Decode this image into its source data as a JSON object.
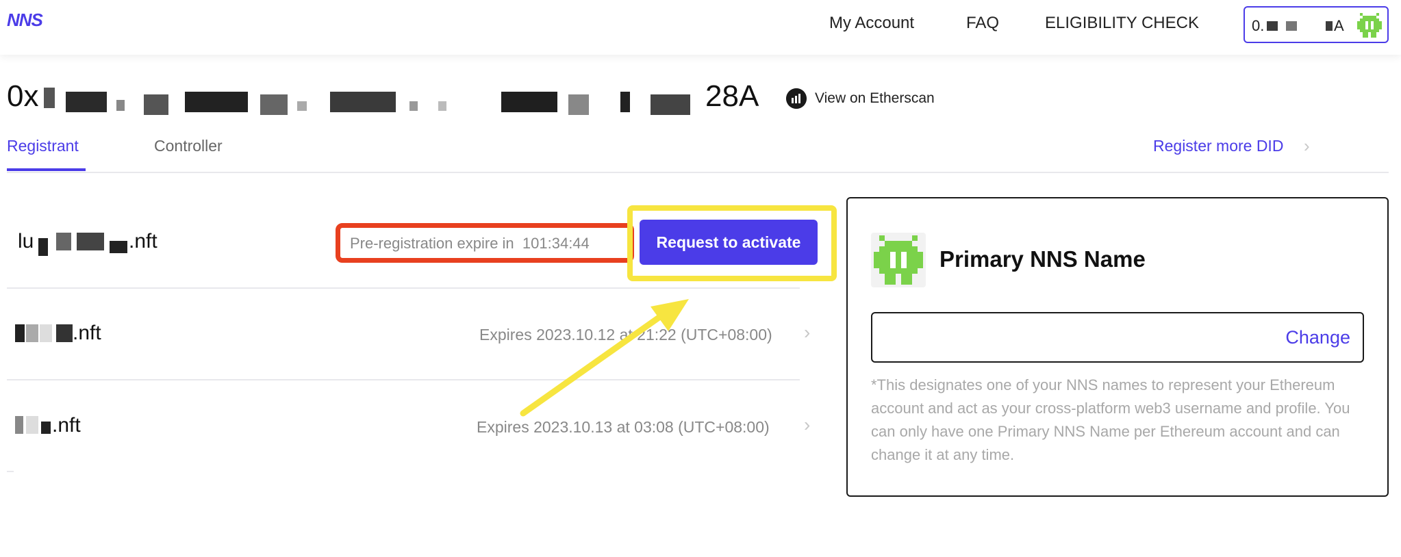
{
  "header": {
    "logo": "NNS",
    "nav": [
      "My Account",
      "FAQ",
      "ELIGIBILITY CHECK"
    ],
    "wallet_prefix": "0.",
    "wallet_suffix": "A"
  },
  "address": {
    "prefix": "0x",
    "suffix": "28A",
    "etherscan_label": "View on Etherscan"
  },
  "tabs": {
    "registrant": "Registrant",
    "controller": "Controller",
    "register_more": "Register more DID"
  },
  "rows": [
    {
      "name_prefix": "lu",
      "name_suffix": ".nft",
      "prereg_label": "Pre-registration expire in",
      "countdown": "101:34:44",
      "action_label": "Request to activate"
    },
    {
      "name_prefix": "",
      "name_suffix": ".nft",
      "expiry": "Expires 2023.10.12 at 21:22 (UTC+08:00)"
    },
    {
      "name_prefix": "",
      "name_suffix": ".nft",
      "expiry": "Expires 2023.10.13 at 03:08 (UTC+08:00)"
    }
  ],
  "primary_card": {
    "title": "Primary NNS Name",
    "change_label": "Change",
    "description": "*This designates one of your NNS names to represent your Ethereum account and act as your cross-platform web3 username and profile. You can only have one Primary NNS Name per Ethereum account and can change it at any time."
  },
  "colors": {
    "accent": "#4B3CE8",
    "highlight_red": "#E8401F",
    "highlight_yellow": "#F7E540",
    "avatar_green": "#7BD24A"
  },
  "icons": {
    "chevron": "chevron-right-icon",
    "etherscan": "etherscan-icon",
    "avatar": "pixel-avatar-icon"
  }
}
